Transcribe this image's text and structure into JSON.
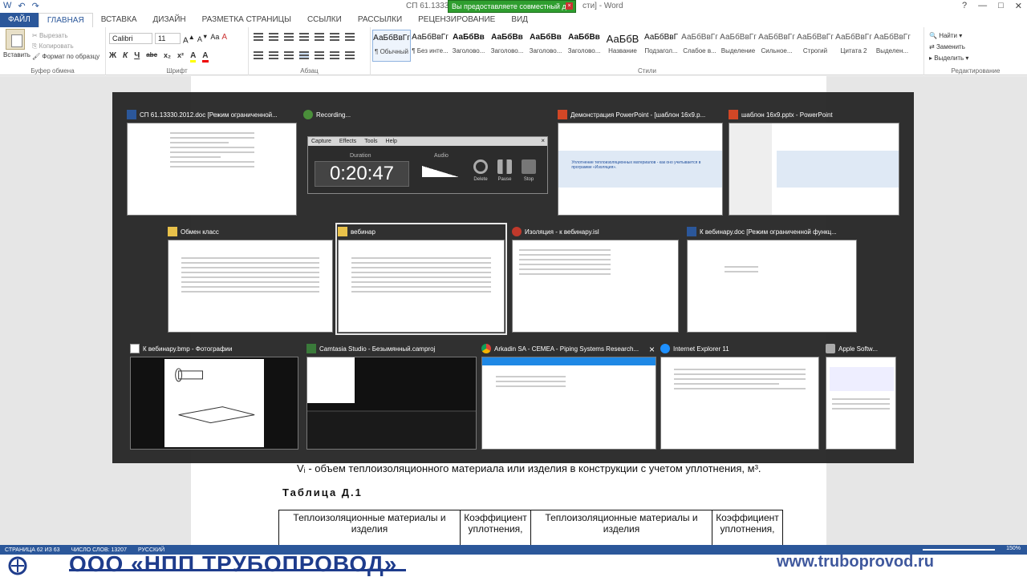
{
  "titlebar": {
    "quick_access": [
      "W",
      "↶",
      "↷"
    ],
    "doc_title": "СП 61.13330.2",
    "share_banner": "Вы предоставляете совместный д",
    "share_close": "×",
    "doc_title_tail": "сти] - Word",
    "window_controls": [
      "?",
      "—",
      "□",
      "✕"
    ]
  },
  "ribbon_tabs": [
    "ФАЙЛ",
    "ГЛАВНАЯ",
    "ВСТАВКА",
    "ДИЗАЙН",
    "РАЗМЕТКА СТРАНИЦЫ",
    "ССЫЛКИ",
    "РАССЫЛКИ",
    "РЕЦЕНЗИРОВАНИЕ",
    "ВИД"
  ],
  "clipboard": {
    "paste": "Вставить",
    "cut": "Вырезать",
    "copy": "Копировать",
    "format_painter": "Формат по образцу",
    "group_label": "Буфер обмена"
  },
  "font": {
    "name": "Calibri",
    "size": "11",
    "format_buttons": [
      "Ж",
      "К",
      "Ч",
      "abc",
      "x₂",
      "x²",
      "A",
      "A"
    ],
    "group_label": "Шрифт"
  },
  "paragraph": {
    "group_label": "Абзац"
  },
  "styles": {
    "items": [
      {
        "preview": "АаБбВвГг",
        "name": "¶ Обычный"
      },
      {
        "preview": "АаБбВвГг",
        "name": "¶ Без инте..."
      },
      {
        "preview": "АаБбВв",
        "name": "Заголово..."
      },
      {
        "preview": "АаБбВв",
        "name": "Заголово..."
      },
      {
        "preview": "АаБбВв",
        "name": "Заголово..."
      },
      {
        "preview": "АаБбВв",
        "name": "Заголово..."
      },
      {
        "preview": "АаБбВ",
        "name": "Название"
      },
      {
        "preview": "АаБбВвГ",
        "name": "Подзагол..."
      },
      {
        "preview": "АаБбВвГг",
        "name": "Слабое в..."
      },
      {
        "preview": "АаБбВвГг",
        "name": "Выделение"
      },
      {
        "preview": "АаБбВвГг",
        "name": "Сильное..."
      },
      {
        "preview": "АаБбВвГг",
        "name": "Строгий"
      },
      {
        "preview": "АаБбВвГг",
        "name": "Цитата 2"
      },
      {
        "preview": "АаБбВвГг",
        "name": "Выделен..."
      }
    ],
    "group_label": "Стили"
  },
  "editing": {
    "find": "Найти",
    "replace": "Заменить",
    "select": "Выделить",
    "group_label": "Редактирование"
  },
  "document": {
    "formula_text": "Vᵢ - объем теплоизоляционного материала или изделия в конструкции с учетом уплотнения, м³.",
    "table_title": "Таблица Д.1",
    "table_headers": [
      "Теплоизоляционные материалы и изделия",
      "Коэффициент уплотнения,",
      "Теплоизоляционные материалы и изделия",
      "Коэффициент уплотнения,"
    ]
  },
  "statusbar": {
    "page": "СТРАНИЦА 62 ИЗ 63",
    "words": "ЧИСЛО СЛОВ: 13207",
    "lang": "РУССКИЙ",
    "zoom": "150%"
  },
  "footer": {
    "company": "ООО «НПП ТРУБОПРОВОД»",
    "site": "www.truboprovod.ru"
  },
  "switcher": {
    "windows": [
      {
        "title": "СП 61.13330.2012.doc [Режим ограниченной...",
        "icon": "word-icon"
      },
      {
        "title": "Recording...",
        "icon": "recording-icon"
      },
      {
        "title": "Демонстрация PowerPoint - [шаблон 16x9.p...",
        "icon": "powerpoint-icon"
      },
      {
        "title": "шаблон 16x9.pptx - PowerPoint",
        "icon": "powerpoint-icon"
      },
      {
        "title": "Обмен класс",
        "icon": "folder-icon"
      },
      {
        "title": "вебинар",
        "icon": "folder-icon"
      },
      {
        "title": "Изоляция - к вебинару.isl",
        "icon": "isolation-app-icon"
      },
      {
        "title": "К вебинару.doc [Режим ограниченной функц...",
        "icon": "word-icon"
      },
      {
        "title": "К вебинару.bmp - Фотографии",
        "icon": "photos-icon"
      },
      {
        "title": "Camtasia Studio - Безымянный.camproj",
        "icon": "camtasia-icon"
      },
      {
        "title": "Arkadin SA - CEMEA - Piping Systems Research...",
        "icon": "chrome-icon"
      },
      {
        "title": "Internet Explorer 11",
        "icon": "ie-icon"
      },
      {
        "title": "Apple Softw...",
        "icon": "apple-icon"
      }
    ],
    "close_glyph": "×"
  },
  "recorder": {
    "menu": [
      "Capture",
      "Effects",
      "Tools",
      "Help"
    ],
    "duration_label": "Duration",
    "audio_label": "Audio",
    "timer": "0:20:47",
    "buttons": [
      "Delete",
      "Pause",
      "Stop"
    ],
    "close": "×"
  },
  "ppt": {
    "slide_title": "Уплотнение теплоизоляционных материалов - как оно учитывается в программе «Изоляция»."
  }
}
